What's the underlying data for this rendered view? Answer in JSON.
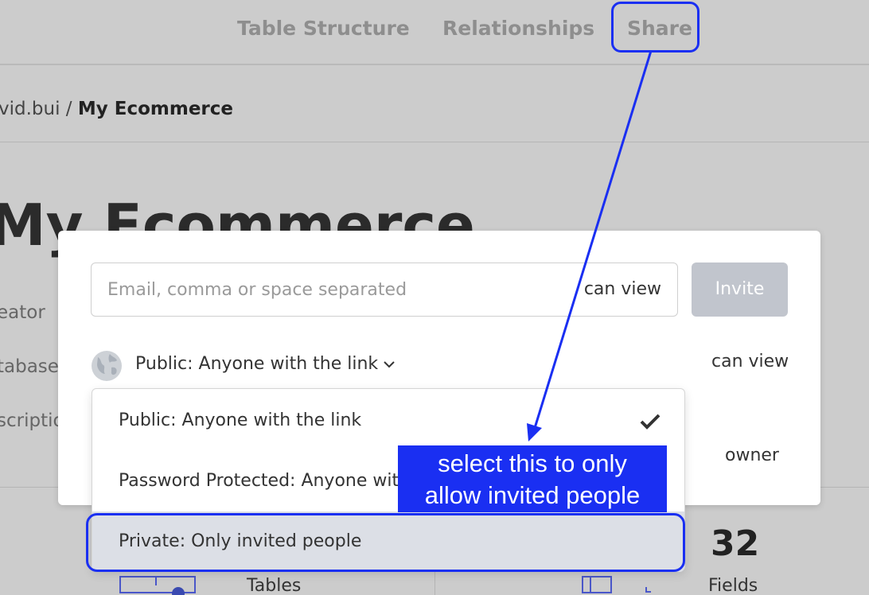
{
  "nav": {
    "tabs": [
      {
        "label": "Table Structure"
      },
      {
        "label": "Relationships"
      },
      {
        "label": "Share"
      }
    ]
  },
  "breadcrumb": {
    "prefix": "vid.bui / ",
    "current": "My Ecommerce"
  },
  "page": {
    "title": "My Ecommerce",
    "labels": {
      "creator": "eator",
      "database": "tabase",
      "description": "scriptio"
    },
    "stats": {
      "tables_label": "Tables",
      "fields_count": "32",
      "fields_label": "Fields"
    }
  },
  "share_modal": {
    "email_placeholder": "Email, comma or space separated",
    "email_value": "",
    "invite_permission": "can view",
    "invite_button": "Invite",
    "access_current": "Public: Anyone with the link",
    "access_permission": "can view",
    "owner_permission": "owner",
    "access_options": [
      {
        "label": "Public: Anyone with the link",
        "selected": true
      },
      {
        "label": "Password Protected: Anyone with the link and password",
        "selected": false
      },
      {
        "label": "Private: Only invited people",
        "selected": false
      }
    ]
  },
  "annotation": {
    "callout_line1": "select this to only",
    "callout_line2": "allow invited people",
    "color": "#1a2ff2"
  }
}
